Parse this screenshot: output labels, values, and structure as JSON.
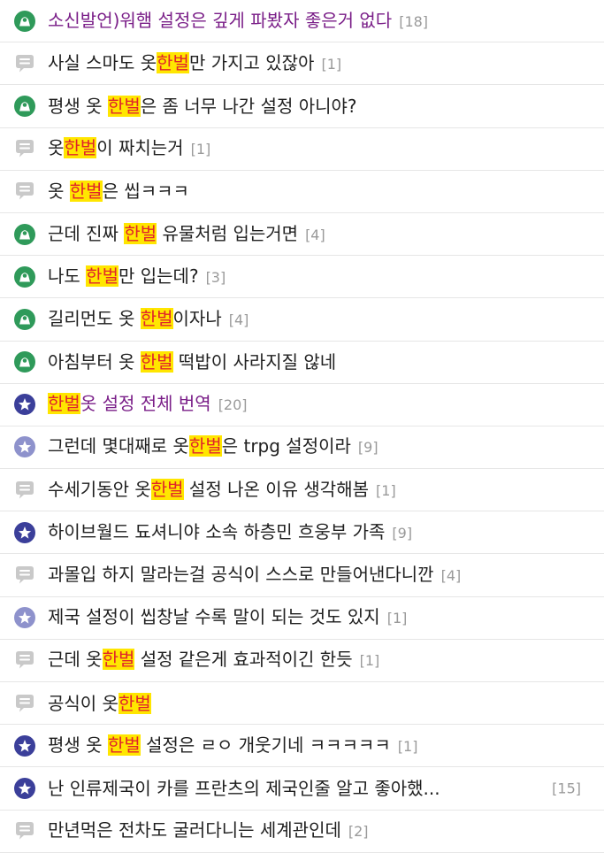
{
  "colors": {
    "green_icon": "#2f9a5a",
    "gray_icon": "#c9c9c9",
    "navy_icon": "#3b3f9a",
    "lavender_icon": "#8e92cc",
    "highlight_bg": "#ffe600",
    "highlight_text": "#e0242b",
    "visited_text": "#7a1e88",
    "count_text": "#9a9a9a"
  },
  "threads": [
    {
      "icon": "green-person",
      "visited": true,
      "parts": [
        "소신발언)워햄 설정은 깊게 파봤자 좋은거 없다"
      ],
      "count": "[18]"
    },
    {
      "icon": "gray-bubble",
      "visited": false,
      "parts": [
        "사실 스마도 옷",
        "한벌",
        "만 가지고 있잖아"
      ],
      "count": "[1]"
    },
    {
      "icon": "green-person",
      "visited": false,
      "parts": [
        "평생 옷 ",
        "한벌",
        "은 좀 너무 나간 설정 아니야?"
      ],
      "count": ""
    },
    {
      "icon": "gray-bubble",
      "visited": false,
      "parts": [
        "옷",
        "한벌",
        "이 짜치는거"
      ],
      "count": "[1]"
    },
    {
      "icon": "gray-bubble",
      "visited": false,
      "parts": [
        "옷 ",
        "한벌",
        "은 씹ㅋㅋㅋ"
      ],
      "count": ""
    },
    {
      "icon": "green-person",
      "visited": false,
      "parts": [
        "근데 진짜 ",
        "한벌",
        " 유물처럼 입는거면"
      ],
      "count": "[4]"
    },
    {
      "icon": "green-person",
      "visited": false,
      "parts": [
        "나도 ",
        "한벌",
        "만 입는데?"
      ],
      "count": "[3]"
    },
    {
      "icon": "green-person",
      "visited": false,
      "parts": [
        "길리먼도 옷 ",
        "한벌",
        "이자나"
      ],
      "count": "[4]"
    },
    {
      "icon": "green-person",
      "visited": false,
      "parts": [
        "아침부터 옷 ",
        "한벌",
        " 떡밥이 사라지질 않네"
      ],
      "count": ""
    },
    {
      "icon": "navy-star",
      "visited": true,
      "parts": [
        "",
        "한벌",
        "옷 설정 전체 번역"
      ],
      "count": "[20]"
    },
    {
      "icon": "lavender-star",
      "visited": false,
      "parts": [
        "그런데 몇대째로 옷",
        "한벌",
        "은 trpg 설정이라"
      ],
      "count": "[9]"
    },
    {
      "icon": "gray-bubble",
      "visited": false,
      "parts": [
        "수세기동안 옷",
        "한벌",
        " 설정 나온 이유 생각해봄"
      ],
      "count": "[1]"
    },
    {
      "icon": "navy-star",
      "visited": false,
      "parts": [
        "하이브월드 됴셔니야 소속 하층민 흐웅부 가족"
      ],
      "count": "[9]"
    },
    {
      "icon": "gray-bubble",
      "visited": false,
      "parts": [
        "과몰입 하지 말라는걸 공식이 스스로 만들어낸다니깐"
      ],
      "count": "[4]"
    },
    {
      "icon": "lavender-star",
      "visited": false,
      "parts": [
        "제국 설정이 씹창날 수록 말이 되는 것도 있지"
      ],
      "count": "[1]"
    },
    {
      "icon": "gray-bubble",
      "visited": false,
      "parts": [
        "근데 옷",
        "한벌",
        " 설정 같은게 효과적이긴 한듯"
      ],
      "count": "[1]"
    },
    {
      "icon": "gray-bubble",
      "visited": false,
      "parts": [
        "공식이 옷",
        "한벌"
      ],
      "count": ""
    },
    {
      "icon": "navy-star",
      "visited": false,
      "parts": [
        "평생 옷 ",
        "한벌",
        " 설정은 ㄹㅇ 개웃기네 ㅋㅋㅋㅋㅋ"
      ],
      "count": "[1]"
    },
    {
      "icon": "navy-star",
      "visited": false,
      "parts": [
        "난 인류제국이 카를 프란츠의 제국인줄 알고 좋아했..."
      ],
      "count": "[15]",
      "count_right": true
    },
    {
      "icon": "gray-bubble",
      "visited": false,
      "parts": [
        "만년먹은 전차도 굴러다니는 세계관인데"
      ],
      "count": "[2]"
    }
  ]
}
